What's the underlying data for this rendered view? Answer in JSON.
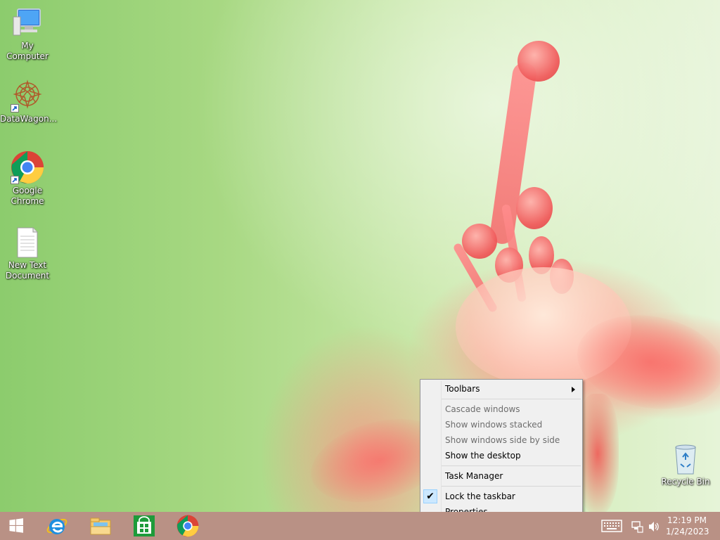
{
  "desktop": {
    "icons": [
      {
        "label": "My Computer",
        "icon": "computer-icon"
      },
      {
        "label": "DataWagon...",
        "icon": "datawagon-icon"
      },
      {
        "label": "Google Chrome",
        "icon": "chrome-icon"
      },
      {
        "label": "New Text Document",
        "icon": "text-document-icon"
      },
      {
        "label": "Recycle Bin",
        "icon": "recycle-bin-icon"
      }
    ]
  },
  "context_menu": {
    "items": [
      {
        "label": "Toolbars",
        "enabled": true,
        "submenu": true
      },
      {
        "label": "Cascade windows",
        "enabled": false
      },
      {
        "label": "Show windows stacked",
        "enabled": false
      },
      {
        "label": "Show windows side by side",
        "enabled": false
      },
      {
        "label": "Show the desktop",
        "enabled": true
      },
      {
        "label": "Task Manager",
        "enabled": true
      },
      {
        "label": "Lock the taskbar",
        "enabled": true,
        "checked": true
      },
      {
        "label": "Properties",
        "enabled": true
      }
    ]
  },
  "taskbar": {
    "color": "#b99185",
    "pinned": [
      {
        "name": "start-button",
        "icon": "windows-logo-icon"
      },
      {
        "name": "internet-explorer",
        "icon": "internet-explorer-icon"
      },
      {
        "name": "file-explorer",
        "icon": "file-explorer-icon"
      },
      {
        "name": "store",
        "icon": "store-icon"
      },
      {
        "name": "chrome",
        "icon": "chrome-icon"
      }
    ],
    "tray": {
      "icons": [
        "keyboard-icon",
        "network-icon",
        "speaker-icon"
      ],
      "time": "12:19 PM",
      "date": "1/24/2023"
    }
  }
}
